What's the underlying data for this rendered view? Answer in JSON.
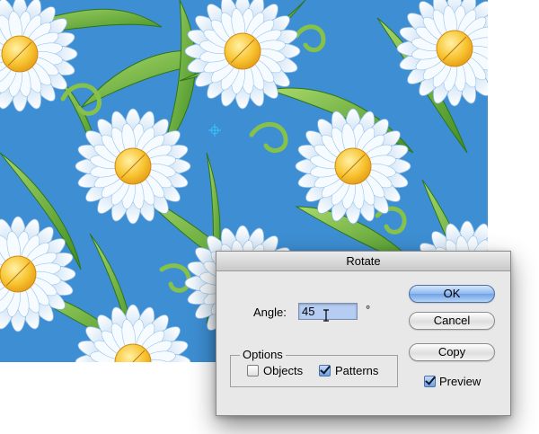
{
  "dialog": {
    "title": "Rotate",
    "angle_label": "Angle:",
    "angle_value": "45",
    "degree_symbol": "°",
    "options_title": "Options",
    "objects_label": "Objects",
    "objects_checked": false,
    "patterns_label": "Patterns",
    "patterns_checked": true,
    "preview_label": "Preview",
    "preview_checked": true,
    "ok_label": "OK",
    "cancel_label": "Cancel",
    "copy_label": "Copy"
  },
  "colors": {
    "canvas_background": "#3d8ed2",
    "petal": "#eef6fd",
    "flower_center": "#f8c431",
    "leaf": "#5aa532",
    "dialog_background": "#e8e8e8",
    "ok_button": "#8db8ef"
  },
  "icons": {
    "cursor": "ibeam-cursor-icon",
    "crosshair": "crosshair-icon"
  }
}
